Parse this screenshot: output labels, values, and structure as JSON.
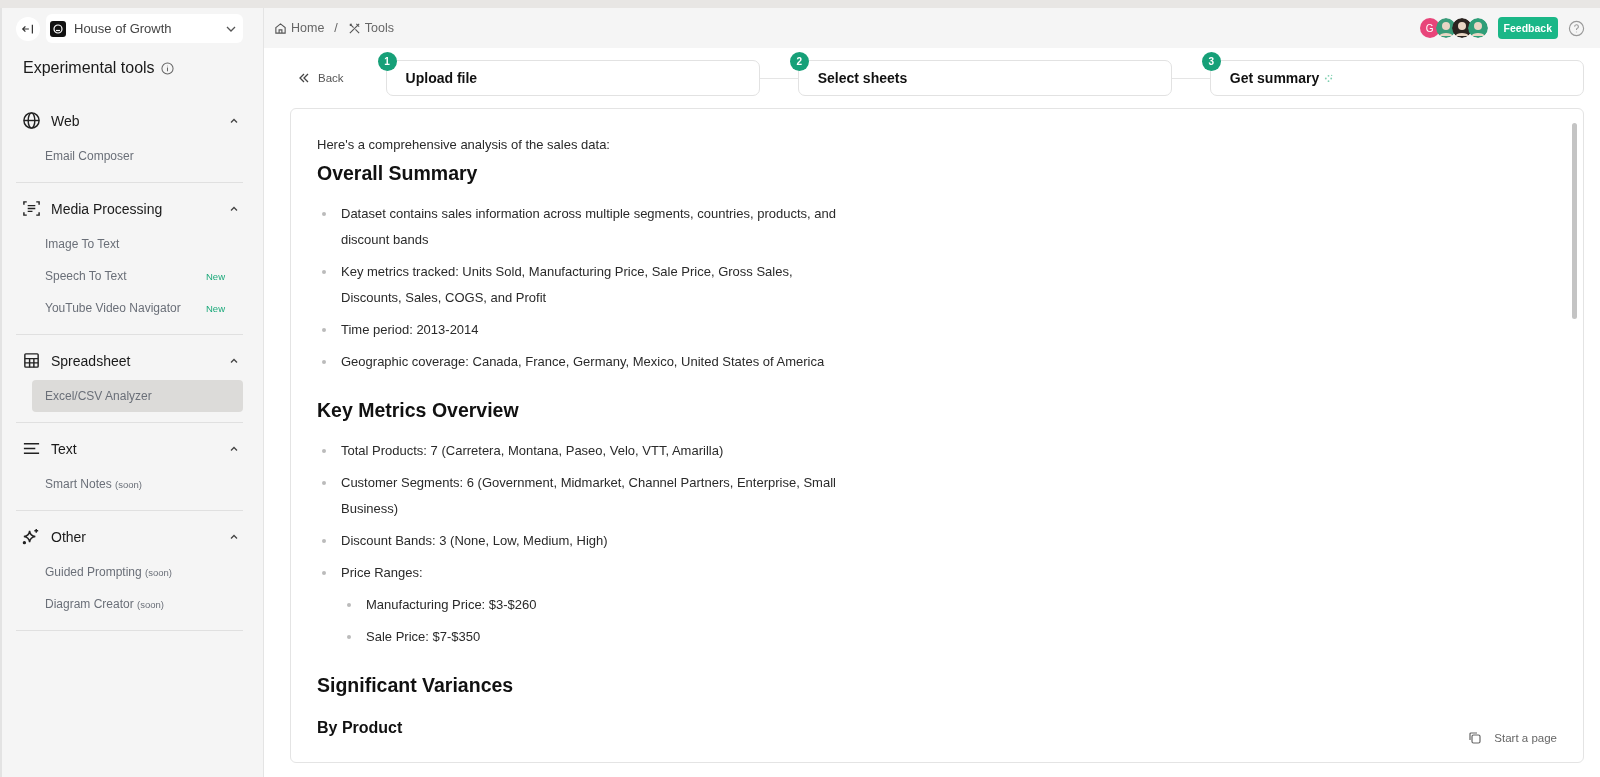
{
  "workspace": {
    "name": "House of Growth"
  },
  "sidebar": {
    "title": "Experimental tools",
    "sections": [
      {
        "title": "Web",
        "expanded": true,
        "items": [
          {
            "label": "Email Composer",
            "selected": false
          }
        ]
      },
      {
        "title": "Media Processing",
        "expanded": true,
        "items": [
          {
            "label": "Image To Text",
            "selected": false
          },
          {
            "label": "Speech To Text",
            "badge": "New",
            "selected": false
          },
          {
            "label": "YouTube Video Navigator",
            "badge": "New",
            "selected": false
          }
        ]
      },
      {
        "title": "Spreadsheet",
        "expanded": true,
        "items": [
          {
            "label": "Excel/CSV Analyzer",
            "selected": true
          }
        ]
      },
      {
        "title": "Text",
        "expanded": true,
        "items": [
          {
            "label": "Smart Notes",
            "note": "(soon)",
            "selected": false
          }
        ]
      },
      {
        "title": "Other",
        "expanded": true,
        "items": [
          {
            "label": "Guided Prompting",
            "note": "(soon)",
            "selected": false
          },
          {
            "label": "Diagram Creator",
            "note": "(soon)",
            "selected": false
          }
        ]
      }
    ]
  },
  "breadcrumb": [
    "Home",
    "Tools"
  ],
  "breadcrumb_separator": "/",
  "avatars": [
    {
      "kind": "initial",
      "text": "G",
      "color": "#e8457a"
    },
    {
      "kind": "photo",
      "color": "#3a9c7a"
    },
    {
      "kind": "photo",
      "color": "#2b2420"
    },
    {
      "kind": "photo",
      "color": "#2f9e78"
    }
  ],
  "feedback": "Feedback",
  "back": "Back",
  "steps": [
    {
      "number": "1",
      "label": "Upload file"
    },
    {
      "number": "2",
      "label": "Select sheets"
    },
    {
      "number": "3",
      "label": "Get summary"
    }
  ],
  "content": [
    {
      "kind": "paragraph",
      "text": "Here's a comprehensive analysis of the sales data:"
    },
    {
      "kind": "heading",
      "text": "Overall Summary"
    },
    {
      "kind": "list",
      "items": [
        {
          "text": "Dataset contains sales information across multiple segments, countries, products, and discount bands"
        },
        {
          "text": "Key metrics tracked: Units Sold, Manufacturing Price, Sale Price, Gross Sales, Discounts, Sales, COGS, and Profit"
        },
        {
          "text": "Time period: 2013-2014"
        },
        {
          "text": "Geographic coverage: Canada, France, Germany, Mexico, United States of America"
        }
      ]
    },
    {
      "kind": "heading",
      "text": "Key Metrics Overview"
    },
    {
      "kind": "list",
      "items": [
        {
          "text": "Total Products: 7 (Carretera, Montana, Paseo, Velo, VTT, Amarilla)"
        },
        {
          "text": "Customer Segments: 6 (Government, Midmarket, Channel Partners, Enterprise, Small Business)"
        },
        {
          "text": "Discount Bands: 3 (None, Low, Medium, High)"
        },
        {
          "text": "Price Ranges:",
          "children": [
            {
              "text": "Manufacturing Price: $3-$260"
            },
            {
              "text": "Sale Price: $7-$350"
            }
          ]
        }
      ]
    },
    {
      "kind": "heading",
      "text": "Significant Variances"
    },
    {
      "kind": "subheading",
      "text": "By Product"
    }
  ],
  "start_page": "Start a page"
}
